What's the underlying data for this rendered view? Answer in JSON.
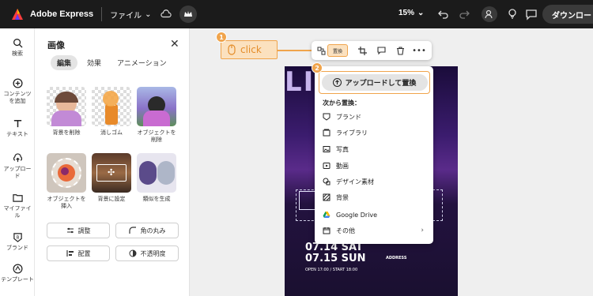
{
  "app": {
    "title": "Adobe Express"
  },
  "topbar": {
    "file_menu": "ファイル",
    "zoom": "15%",
    "download_label": "ダウンロード"
  },
  "rail": [
    {
      "label": "検索",
      "icon": "search-icon"
    },
    {
      "label": "コンテンツを追加",
      "icon": "plus-circle-icon"
    },
    {
      "label": "テキスト",
      "icon": "text-icon"
    },
    {
      "label": "アップロード",
      "icon": "upload-icon"
    },
    {
      "label": "マイファイル",
      "icon": "folder-icon"
    },
    {
      "label": "ブランド",
      "icon": "brand-icon"
    },
    {
      "label": "テンプレート",
      "icon": "template-icon"
    }
  ],
  "panel": {
    "title": "画像",
    "tabs": [
      "編集",
      "効果",
      "アニメーション"
    ],
    "tools": [
      "背景を削除",
      "消しゴム",
      "オブジェクトを削除",
      "オブジェクトを挿入",
      "背景に設定",
      "類似を生成"
    ],
    "buttons": [
      "調整",
      "角の丸み",
      "配置",
      "不透明度"
    ]
  },
  "annotation": {
    "step1": "1",
    "step2": "2",
    "click_label": "click"
  },
  "float_toolbar": {
    "replace_label": "置換"
  },
  "dropdown": {
    "upload_label": "アップロードして置換",
    "heading": "次から置換：",
    "items": [
      "ブランド",
      "ライブラリ",
      "写真",
      "動画",
      "デザイン素材",
      "背景",
      "Google Drive",
      "その他"
    ]
  },
  "poster": {
    "date1": "07.14 SAT",
    "date2": "07.15 SUN",
    "time": "OPEN 17:00 / START 18:00",
    "address_label": "ADDRESS"
  },
  "colors": {
    "accent": "#f0a44c",
    "topbar": "#1b1b1b"
  }
}
